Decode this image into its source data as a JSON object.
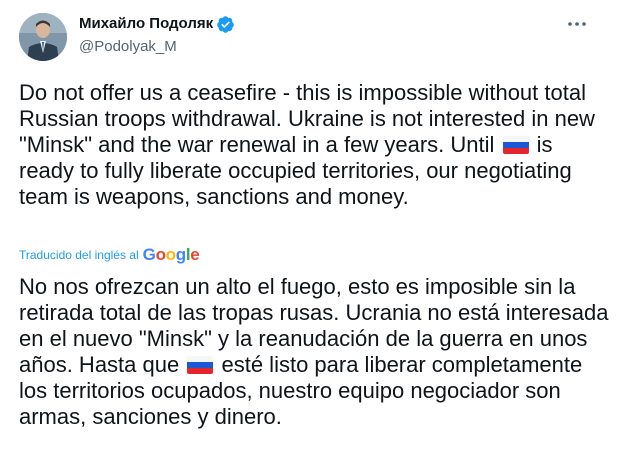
{
  "tweet": {
    "author_name": "Михайло Подоляк",
    "author_handle": "@Podolyak_M",
    "text_parts": [
      "Do not offer us a ceasefire - this is impossible without total Russian troops withdrawal. Ukraine is not interested in new \"Minsk\" and the war renewal in a few years. Until",
      "is ready to fully liberate occupied territories, our negotiating team is weapons, sanctions and money."
    ],
    "translation_note": "Traducido del inglés al",
    "translation_provider": "Google",
    "translation_parts": [
      "No nos ofrezcan un alto el fuego, esto es imposible sin la retirada total de las tropas rusas. Ucrania no está interesada en el nuevo \"Minsk\" y la reanudación de la guerra en unos años. Hasta que",
      "esté listo para liberar completamente los territorios ocupados, nuestro equipo negociador son armas, sanciones y dinero."
    ],
    "flag_icon": "russia-flag-icon",
    "verified_icon": "verified-badge-icon",
    "more_icon": "more-options-icon"
  },
  "colors": {
    "accent": "#1d9bf0",
    "text": "#0f1419",
    "secondary_text": "#536471"
  }
}
